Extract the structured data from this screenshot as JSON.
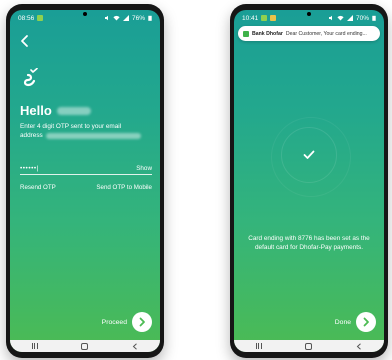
{
  "left_phone": {
    "status": {
      "time": "08:56",
      "battery": "76%"
    },
    "greeting": "Hello",
    "otp_message": "Enter 4 digit OTP sent to your email",
    "otp_message_line2": "address",
    "otp_value": "••••••|",
    "show_label": "Show",
    "resend_label": "Resend OTP",
    "send_mobile_label": "Send OTP to Mobile",
    "proceed_label": "Proceed"
  },
  "right_phone": {
    "status": {
      "time": "10:41",
      "battery": "70%"
    },
    "notification": {
      "sender": "Bank Dhofar",
      "text": "Dear Customer, Your card ending..."
    },
    "success_message": "Card ending with 8776 has been set as the default card for Dhofar-Pay payments.",
    "done_label": "Done"
  },
  "icons": {
    "back": "chevron-left-icon",
    "logo": "bank-logo-icon",
    "check": "checkmark-icon",
    "arrow": "chevron-right-icon",
    "wifi": "wifi-icon",
    "signal": "signal-icon",
    "battery": "battery-icon"
  },
  "colors": {
    "gradient_top": "#1a9e96",
    "gradient_bottom": "#4cbb53",
    "arrow_accent": "#4cbb53",
    "notif_icon": "#3fb24a"
  }
}
